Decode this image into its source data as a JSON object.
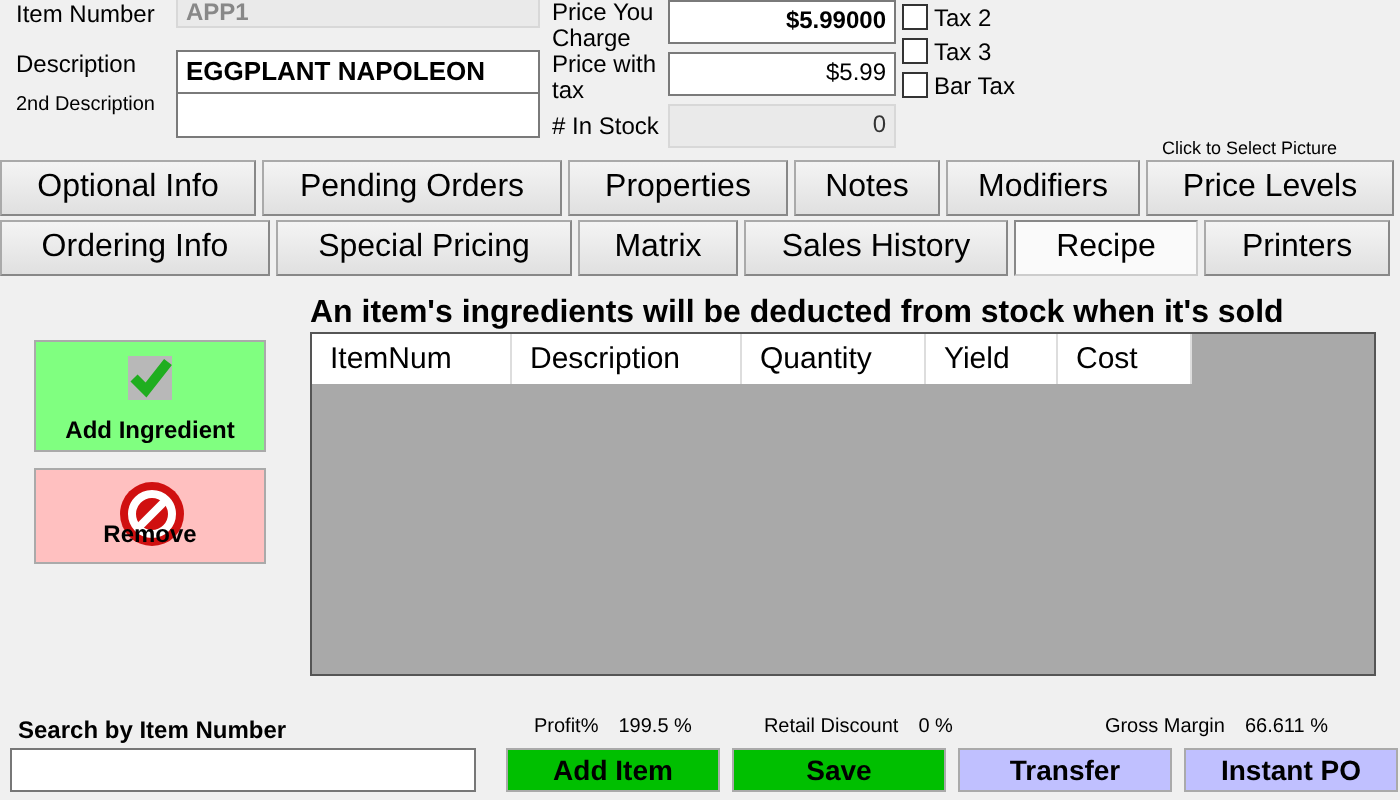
{
  "item": {
    "number_label": "Item Number",
    "number": "APP1",
    "description_label": "Description",
    "description": "EGGPLANT NAPOLEON",
    "description2_label": "2nd Description"
  },
  "pricing": {
    "charge_label": "Price You Charge",
    "charge": "$5.99000",
    "with_tax_label": "Price with tax",
    "with_tax": "$5.99",
    "stock_label": "# In Stock",
    "stock": "0"
  },
  "taxes": [
    {
      "label": "Tax 2",
      "checked": false
    },
    {
      "label": "Tax 3",
      "checked": false
    },
    {
      "label": "Bar Tax",
      "checked": false
    }
  ],
  "picture_hint": "Click to Select Picture",
  "tab_rows": [
    [
      {
        "label": "Optional Info",
        "selected": false
      },
      {
        "label": "Pending Orders",
        "selected": false
      },
      {
        "label": "Properties",
        "selected": false
      },
      {
        "label": "Notes",
        "selected": false
      },
      {
        "label": "Modifiers",
        "selected": false
      },
      {
        "label": "Price Levels",
        "selected": false
      }
    ],
    [
      {
        "label": "Ordering Info",
        "selected": false
      },
      {
        "label": "Special Pricing",
        "selected": false
      },
      {
        "label": "Matrix",
        "selected": false
      },
      {
        "label": "Sales History",
        "selected": false
      },
      {
        "label": "Recipe",
        "selected": true
      },
      {
        "label": "Printers",
        "selected": false
      }
    ]
  ],
  "recipe": {
    "heading": "An item's ingredients will be deducted from stock when it's sold",
    "add_button": "Add Ingredient",
    "remove_button": "Remove",
    "columns": [
      "ItemNum",
      "Description",
      "Quantity",
      "Yield",
      "Cost"
    ]
  },
  "search": {
    "label": "Search by Item Number"
  },
  "stats": [
    {
      "label": "Profit%",
      "value": "199.5 %"
    },
    {
      "label": "Retail Discount",
      "value": "0 %"
    },
    {
      "label": "Gross Margin",
      "value": "66.611 %"
    }
  ],
  "actions": [
    {
      "label": "Add Item",
      "kind": "green"
    },
    {
      "label": "Save",
      "kind": "green"
    },
    {
      "label": "Transfer",
      "kind": "lavender"
    },
    {
      "label": "Instant PO",
      "kind": "lavender"
    }
  ]
}
